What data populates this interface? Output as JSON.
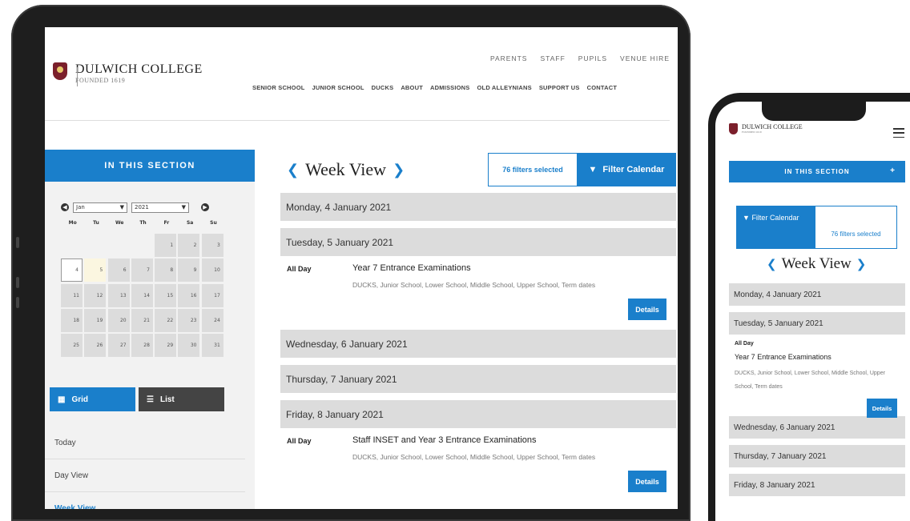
{
  "brand": {
    "name": "DULWICH COLLEGE",
    "founded": "FOUNDED 1619",
    "crest_color": "#7b1f2b"
  },
  "colors": {
    "accent": "#1a7fcb",
    "day_bar": "#dcdcdc",
    "dark_button": "#444444"
  },
  "top_nav": [
    "PARENTS",
    "STAFF",
    "PUPILS",
    "VENUE HIRE"
  ],
  "main_nav": [
    "SENIOR SCHOOL",
    "JUNIOR SCHOOL",
    "DUCKS",
    "ABOUT",
    "ADMISSIONS",
    "OLD ALLEYNIANS",
    "SUPPORT US",
    "CONTACT"
  ],
  "sidebar": {
    "section_title": "IN THIS SECTION",
    "calendar": {
      "month": "Jan",
      "year": "2021",
      "weekdays": [
        "Mo",
        "Tu",
        "We",
        "Th",
        "Fr",
        "Sa",
        "Su"
      ],
      "days": [
        "",
        "",
        "",
        "",
        "1",
        "2",
        "3",
        "4",
        "5",
        "6",
        "7",
        "8",
        "9",
        "10",
        "11",
        "12",
        "13",
        "14",
        "15",
        "16",
        "17",
        "18",
        "19",
        "20",
        "21",
        "22",
        "23",
        "24",
        "25",
        "26",
        "27",
        "28",
        "29",
        "30",
        "31"
      ],
      "selected_day": "4",
      "today": "5"
    },
    "grid_label": "Grid",
    "list_label": "List",
    "links": [
      "Today",
      "Day View",
      "Week View"
    ]
  },
  "main": {
    "week_title": "Week View",
    "filters_selected": "76 filters selected",
    "filter_button": "Filter Calendar",
    "days": [
      {
        "label": "Monday, 4 January 2021",
        "events": []
      },
      {
        "label": "Tuesday, 5 January 2021",
        "events": [
          {
            "when": "All Day",
            "title": "Year 7 Entrance Examinations",
            "categories": "DUCKS, Junior School, Lower School, Middle School, Upper School, Term dates",
            "details": "Details"
          }
        ]
      },
      {
        "label": "Wednesday, 6 January 2021",
        "events": []
      },
      {
        "label": "Thursday, 7 January 2021",
        "events": []
      },
      {
        "label": "Friday, 8 January 2021",
        "events": [
          {
            "when": "All Day",
            "title": "Staff INSET and Year 3 Entrance Examinations",
            "categories": "DUCKS, Junior School, Lower School, Middle School, Upper School, Term dates",
            "details": "Details"
          }
        ]
      }
    ]
  },
  "phone": {
    "section_title": "IN THIS SECTION",
    "section_plus": "+",
    "filter_button": "Filter Calendar",
    "filters_selected": "76 filters selected",
    "week_title": "Week View",
    "days": [
      {
        "label": "Monday, 4 January 2021",
        "events": []
      },
      {
        "label": "Tuesday, 5 January 2021",
        "events": [
          {
            "when": "All Day",
            "title": "Year 7 Entrance Examinations",
            "categories": "DUCKS, Junior School, Lower School, Middle School, Upper School, Term dates",
            "details": "Details"
          }
        ]
      },
      {
        "label": "Wednesday, 6 January 2021",
        "events": []
      },
      {
        "label": "Thursday, 7 January 2021",
        "events": []
      },
      {
        "label": "Friday, 8 January 2021",
        "events": []
      }
    ]
  }
}
